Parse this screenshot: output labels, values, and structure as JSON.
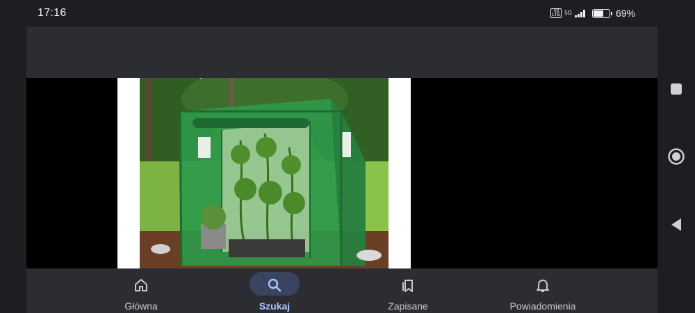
{
  "status_bar": {
    "time": "17:16",
    "volte": "Vo LTE",
    "network": "5G",
    "battery_level": 0.69,
    "battery_text": "69%"
  },
  "image": {
    "subject": "walk-in greenhouse with green cover, open door, plants inside",
    "colors": {
      "cover": "#2e9a4a",
      "frame": "#1d6b33",
      "soil": "#6b3f25",
      "grass": "#7cb342"
    }
  },
  "bottom_nav": {
    "items": [
      {
        "label": "Główna",
        "icon": "home-icon",
        "active": false
      },
      {
        "label": "Szukaj",
        "icon": "search-icon",
        "active": true
      },
      {
        "label": "Zapisane",
        "icon": "bookmarks-icon",
        "active": false
      },
      {
        "label": "Powiadomienia",
        "icon": "bell-icon",
        "active": false
      }
    ]
  },
  "system_nav": {
    "buttons": [
      "recents-icon",
      "home-circle-icon",
      "back-icon"
    ]
  },
  "theme": {
    "background": "#1d1e22",
    "surface": "#2b2d33",
    "accent": "#aac7ff",
    "accent_pill": "#3a4460"
  }
}
